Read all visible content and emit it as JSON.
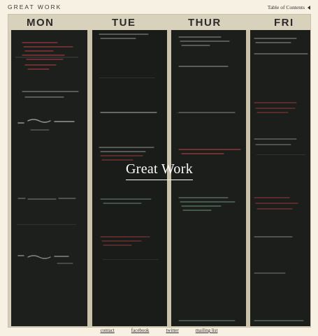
{
  "header": {
    "site_title": "GREAT WORK",
    "toc_label": "Table of Contents",
    "toc_icon": "triangle-left-icon"
  },
  "hero": {
    "title": "Great Work",
    "board_days": [
      "MON",
      "TUE",
      "THUR",
      "FRI"
    ],
    "chalk_colors": {
      "white": "#d8dcd6",
      "red": "#c24848",
      "green": "#8db59a"
    }
  },
  "footer": {
    "links": [
      "contact",
      "facebook",
      "twitter",
      "mailing list"
    ]
  }
}
